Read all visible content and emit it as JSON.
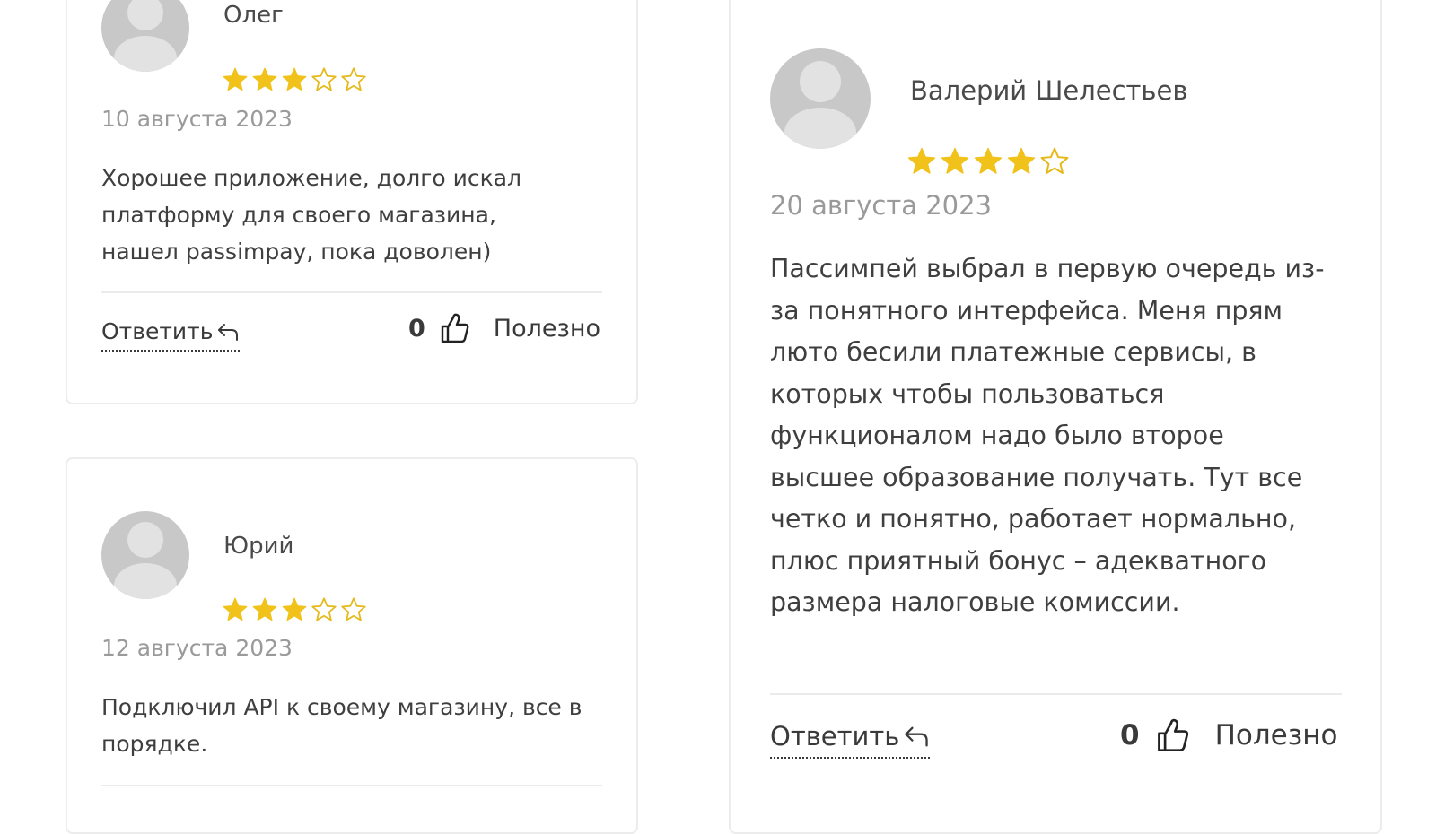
{
  "colors": {
    "star": "#f0c21a",
    "star_empty_stroke": "#e6b91a",
    "text": "#3f3f3f",
    "date": "#9a9a9a",
    "border": "#ececec"
  },
  "reviews": [
    {
      "name": "Олег",
      "rating": 3,
      "max_rating": 5,
      "date": "10 августа 2023",
      "text": "Хорошее приложение, долго искал платформу для своего магазина, нашел passimpay, пока доволен)",
      "reply_label": "Ответить",
      "likes": "0",
      "useful_label": "Полезно"
    },
    {
      "name": "Юрий",
      "rating": 3,
      "max_rating": 5,
      "date": "12 августа 2023",
      "text": "Подключил API к своему магазину, все в порядке."
    },
    {
      "name": "Валерий Шелестьев",
      "rating": 4,
      "max_rating": 5,
      "date": "20 августа 2023",
      "text": "Пассимпей выбрал в первую очередь из-за понятного интерфейса. Меня прям люто бесили платежные сервисы, в которых чтобы пользоваться функционалом надо было второе высшее образование получать. Тут все четко и понятно, работает нормально, плюс приятный бонус – адекватного размера налоговые комиссии.",
      "reply_label": "Ответить",
      "likes": "0",
      "useful_label": "Полезно"
    }
  ],
  "icons": {
    "avatar": "user-placeholder-icon",
    "star_full": "star-filled-icon",
    "star_empty": "star-outline-icon",
    "reply": "reply-arrow-icon",
    "like": "thumbs-up-icon"
  }
}
